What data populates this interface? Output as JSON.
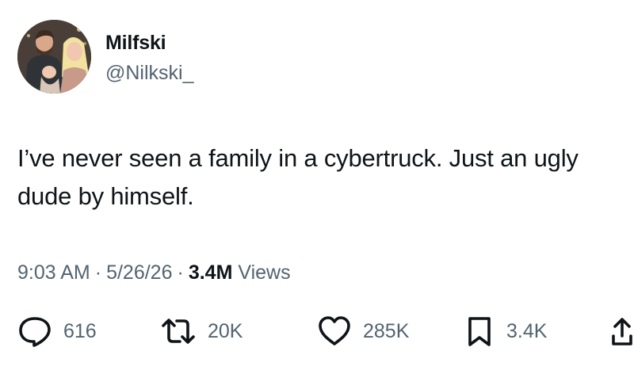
{
  "author": {
    "display_name": "Milfski",
    "handle": "@Nilkski_"
  },
  "tweet": {
    "text": "I’ve never seen a family in a cybertruck. Just an ugly dude by himself."
  },
  "meta": {
    "time": "9:03 AM",
    "date": "5/26/26",
    "views_count": "3.4M",
    "views_label": "Views",
    "separator": "·"
  },
  "actions": {
    "replies": "616",
    "reposts": "20K",
    "likes": "285K",
    "bookmarks": "3.4K"
  },
  "icons": {
    "reply": "reply-icon",
    "repost": "repost-icon",
    "like": "heart-icon",
    "bookmark": "bookmark-icon",
    "share": "share-icon"
  },
  "colors": {
    "text": "#0f1419",
    "secondary": "#536471",
    "background": "#ffffff"
  }
}
